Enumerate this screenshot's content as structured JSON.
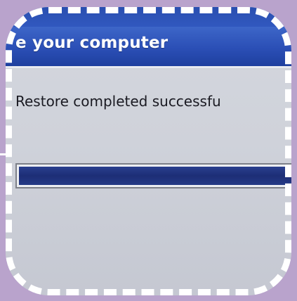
{
  "dialog": {
    "title": "e your computer",
    "status_message": "Restore completed successfu",
    "progress_percent": 100
  },
  "colors": {
    "background": "#b9a3cc",
    "title_bar": "#2b4fb6",
    "progress_fill": "#1d2e76",
    "frame_border": "#ffffff"
  }
}
